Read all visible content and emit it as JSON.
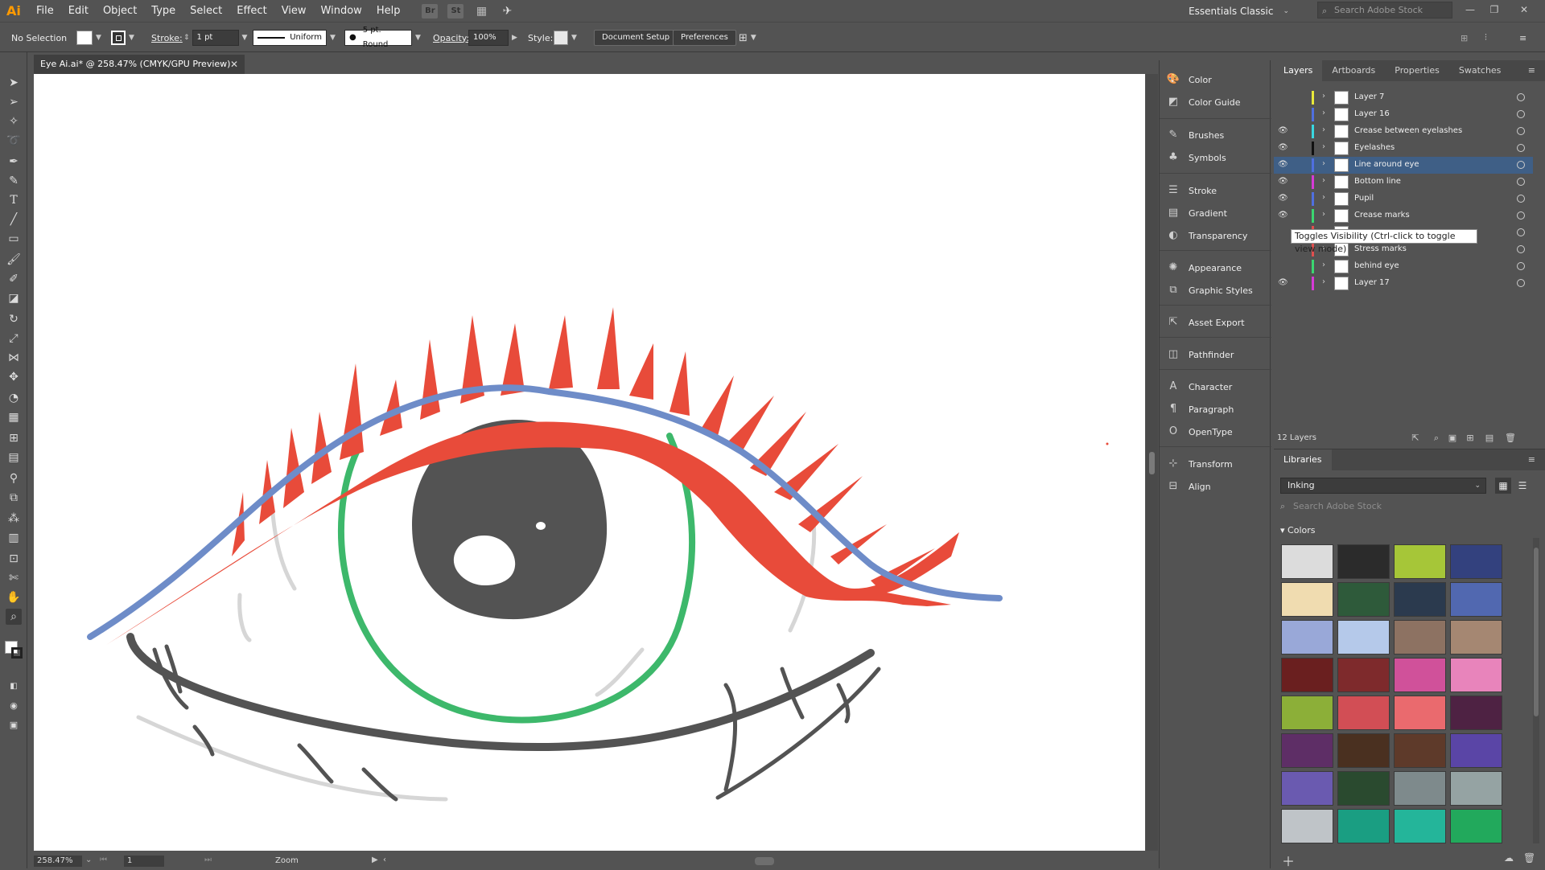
{
  "app": {
    "logo": "Ai",
    "menu": [
      "File",
      "Edit",
      "Object",
      "Type",
      "Select",
      "Effect",
      "View",
      "Window",
      "Help"
    ],
    "bridge_label": "Br",
    "stock_label": "St",
    "workspace": "Essentials Classic",
    "stock_search_placeholder": "Search Adobe Stock"
  },
  "control_bar": {
    "selection": "No Selection",
    "stroke_label": "Stroke:",
    "stroke_value": "1 pt",
    "profile": "Uniform",
    "brush": "5 pt. Round",
    "opacity_label": "Opacity:",
    "opacity_value": "100%",
    "style_label": "Style:",
    "document_setup": "Document Setup",
    "preferences": "Preferences"
  },
  "document": {
    "tab_title": "Eye Ai.ai* @ 258.47% (CMYK/GPU Preview)",
    "zoom": "258.47%",
    "artboard": "1",
    "status_label": "Zoom"
  },
  "dock": [
    {
      "label": "Color",
      "icon": "color-icon"
    },
    {
      "label": "Color Guide",
      "icon": "color-guide-icon"
    },
    {
      "label": "Brushes",
      "icon": "brushes-icon"
    },
    {
      "label": "Symbols",
      "icon": "symbols-icon"
    },
    {
      "label": "Stroke",
      "icon": "stroke-icon"
    },
    {
      "label": "Gradient",
      "icon": "gradient-icon"
    },
    {
      "label": "Transparency",
      "icon": "transparency-icon"
    },
    {
      "label": "Appearance",
      "icon": "appearance-icon"
    },
    {
      "label": "Graphic Styles",
      "icon": "graphic-styles-icon"
    },
    {
      "label": "Asset Export",
      "icon": "asset-export-icon"
    },
    {
      "label": "Pathfinder",
      "icon": "pathfinder-icon"
    },
    {
      "label": "Character",
      "icon": "character-icon"
    },
    {
      "label": "Paragraph",
      "icon": "paragraph-icon"
    },
    {
      "label": "OpenType",
      "icon": "opentype-icon"
    },
    {
      "label": "Transform",
      "icon": "transform-icon"
    },
    {
      "label": "Align",
      "icon": "align-icon"
    }
  ],
  "layers_panel": {
    "tabs": [
      "Layers",
      "Artboards",
      "Properties",
      "Swatches"
    ],
    "layers": [
      {
        "name": "Layer 7",
        "visible": false,
        "color": "#e8e83a",
        "selected": false
      },
      {
        "name": "Layer 16",
        "visible": false,
        "color": "#4f6fe0",
        "selected": false
      },
      {
        "name": "Crease between eyelashes",
        "visible": true,
        "color": "#39d7e0",
        "selected": false
      },
      {
        "name": "Eyelashes",
        "visible": true,
        "color": "#111111",
        "selected": false
      },
      {
        "name": "Line around eye",
        "visible": true,
        "color": "#4f6fe0",
        "selected": true
      },
      {
        "name": "Bottom line",
        "visible": true,
        "color": "#d63ad6",
        "selected": false
      },
      {
        "name": "Pupil",
        "visible": true,
        "color": "#4f6fe0",
        "selected": false
      },
      {
        "name": "Crease marks",
        "visible": true,
        "color": "#3ad670",
        "selected": false
      },
      {
        "name": "",
        "visible": false,
        "color": "#e04f4f",
        "selected": false
      },
      {
        "name": "Stress marks",
        "visible": false,
        "color": "#e04f4f",
        "selected": false
      },
      {
        "name": "behind eye",
        "visible": false,
        "color": "#3ad670",
        "selected": false
      },
      {
        "name": "Layer 17",
        "visible": true,
        "color": "#d63ad6",
        "selected": false
      }
    ],
    "tooltip": "Toggles Visibility (Ctrl-click to toggle view mode)",
    "count": "12 Layers"
  },
  "libraries_panel": {
    "title": "Libraries",
    "library": "Inking",
    "search_placeholder": "Search Adobe Stock",
    "colors_heading": "Colors",
    "swatches": [
      "#dcdcdc",
      "#2b2b2b",
      "#a6c638",
      "#33417e",
      "#f0dcb0",
      "#2e5a3a",
      "#2b3a4e",
      "#5168b0",
      "#99a8d8",
      "#b5c9ea",
      "#8d7262",
      "#a58772",
      "#6a1f1f",
      "#7e2a2c",
      "#d0519a",
      "#e884bb",
      "#8caf38",
      "#d24e55",
      "#ea6a6e",
      "#4e2243",
      "#5e2e66",
      "#4a3020",
      "#5e3a2a",
      "#5a45a6",
      "#6a5ab0",
      "#2a4a2f",
      "#7e8a8c",
      "#95a3a3",
      "#bfc4c8",
      "#1a9e82",
      "#24b59a",
      "#22a95c"
    ]
  }
}
